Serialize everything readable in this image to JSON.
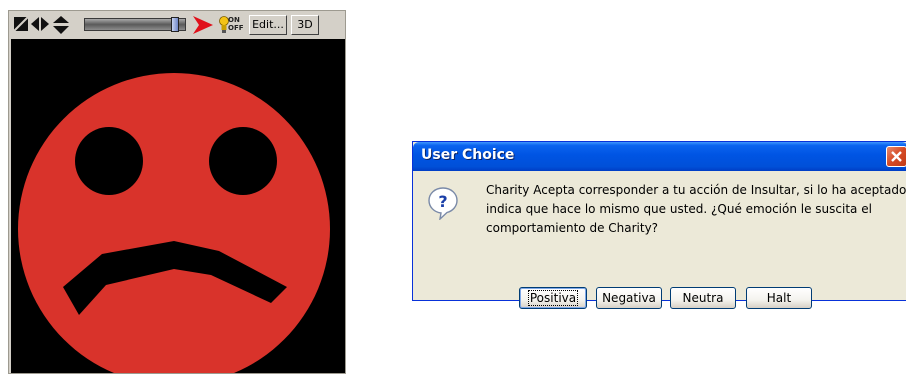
{
  "viewer": {
    "toolbar": {
      "edit_label": "Edit...",
      "view3d_label": "3D",
      "onoff_label": "ON OFF",
      "icons": [
        "zoom-icon",
        "pan-horizontal-icon",
        "pan-vertical-icon",
        "play-arrow-icon",
        "lightbulb-icon"
      ],
      "slider_value": 0.93
    },
    "face": {
      "expression": "sad",
      "face_color": "#d9332b",
      "background": "#000000"
    }
  },
  "dialog": {
    "title": "User Choice",
    "message_lines": [
      "Charity Acepta corresponder a tu acción de Insultar, si lo ha aceptado",
      "indica que hace lo mismo que usted. ¿Qué emoción le suscita el",
      "comportamiento de Charity?"
    ],
    "icon": "question-icon",
    "buttons": [
      "Positiva",
      "Negativa",
      "Neutra",
      "Halt"
    ]
  }
}
